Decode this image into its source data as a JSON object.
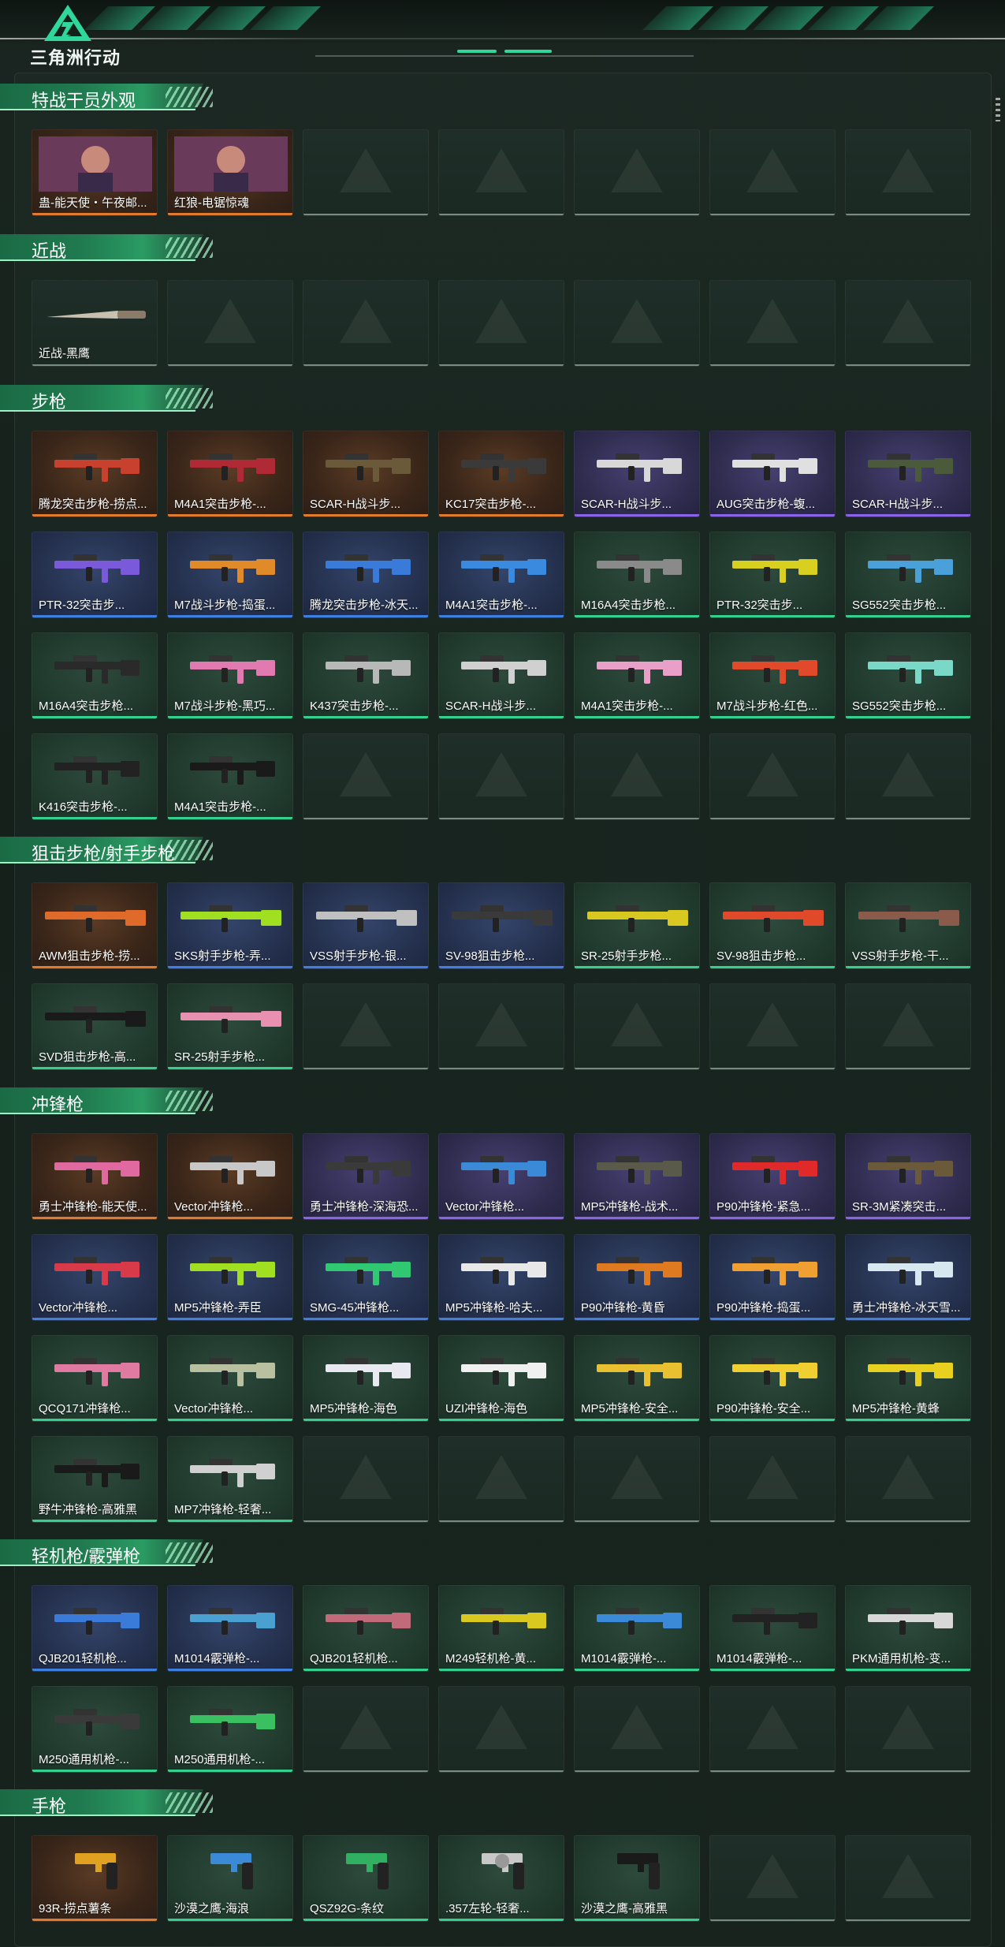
{
  "app": {
    "brand": "三角洲行动"
  },
  "sections": [
    {
      "title": "特战干员外观",
      "rows": [
        [
          {
            "label": "蛊-能天使・午夜邮...",
            "rarity": "gold",
            "icon": "operator-skin-art"
          },
          {
            "label": "红狼-电锯惊魂",
            "rarity": "gold",
            "icon": "operator-skin-art"
          },
          {
            "empty": true
          },
          {
            "empty": true
          },
          {
            "empty": true
          },
          {
            "empty": true
          },
          {
            "empty": true
          }
        ]
      ]
    },
    {
      "title": "近战",
      "rows": [
        [
          {
            "label": "近战-黑鹰",
            "rarity": "empty",
            "icon": "knife-icon"
          },
          {
            "empty": true
          },
          {
            "empty": true
          },
          {
            "empty": true
          },
          {
            "empty": true
          },
          {
            "empty": true
          },
          {
            "empty": true
          }
        ]
      ]
    },
    {
      "title": "步枪",
      "rows": [
        [
          {
            "label": "腾龙突击步枪-捞点...",
            "rarity": "gold",
            "icon": "rifle-icon",
            "color": "#c8412e"
          },
          {
            "label": "M4A1突击步枪-...",
            "rarity": "gold",
            "icon": "rifle-icon",
            "color": "#b02a36"
          },
          {
            "label": "SCAR-H战斗步...",
            "rarity": "gold",
            "icon": "rifle-icon",
            "color": "#6a5a3a"
          },
          {
            "label": "KC17突击步枪-...",
            "rarity": "gold",
            "icon": "rifle-icon",
            "color": "#3a3a3a"
          },
          {
            "label": "SCAR-H战斗步...",
            "rarity": "purple",
            "icon": "rifle-icon",
            "color": "#d8d8d8"
          },
          {
            "label": "AUG突击步枪-蝮...",
            "rarity": "purple",
            "icon": "rifle-icon",
            "color": "#e0e0e0"
          },
          {
            "label": "SCAR-H战斗步...",
            "rarity": "purple",
            "icon": "rifle-icon",
            "color": "#4a5a3a"
          }
        ],
        [
          {
            "label": "PTR-32突击步...",
            "rarity": "blue",
            "icon": "rifle-icon",
            "color": "#7a5ad8"
          },
          {
            "label": "M7战斗步枪-捣蛋...",
            "rarity": "blue",
            "icon": "rifle-icon",
            "color": "#e08a2a"
          },
          {
            "label": "腾龙突击步枪-冰天...",
            "rarity": "blue",
            "icon": "rifle-icon",
            "color": "#3a7ad8"
          },
          {
            "label": "M4A1突击步枪-...",
            "rarity": "blue",
            "icon": "rifle-icon",
            "color": "#3a8ae0"
          },
          {
            "label": "M16A4突击步枪...",
            "rarity": "green",
            "icon": "rifle-icon",
            "color": "#8a8a8a"
          },
          {
            "label": "PTR-32突击步...",
            "rarity": "green",
            "icon": "rifle-icon",
            "color": "#d8d020"
          },
          {
            "label": "SG552突击步枪...",
            "rarity": "green",
            "icon": "rifle-icon",
            "color": "#4aa0d8"
          }
        ],
        [
          {
            "label": "M16A4突击步枪...",
            "rarity": "green",
            "icon": "rifle-icon",
            "color": "#2a2a2a"
          },
          {
            "label": "M7战斗步枪-黑巧...",
            "rarity": "green",
            "icon": "rifle-icon",
            "color": "#e07ab0"
          },
          {
            "label": "K437突击步枪-...",
            "rarity": "green",
            "icon": "rifle-icon",
            "color": "#b8b8b8"
          },
          {
            "label": "SCAR-H战斗步...",
            "rarity": "green",
            "icon": "rifle-icon",
            "color": "#d0d0d0"
          },
          {
            "label": "M4A1突击步枪-...",
            "rarity": "green",
            "icon": "rifle-icon",
            "color": "#e8a0c8"
          },
          {
            "label": "M7战斗步枪-红色...",
            "rarity": "green",
            "icon": "rifle-icon",
            "color": "#e04a2a"
          },
          {
            "label": "SG552突击步枪...",
            "rarity": "green",
            "icon": "rifle-icon",
            "color": "#7ad8c8"
          }
        ],
        [
          {
            "label": "K416突击步枪-...",
            "rarity": "green",
            "icon": "rifle-icon",
            "color": "#222222"
          },
          {
            "label": "M4A1突击步枪-...",
            "rarity": "green",
            "icon": "rifle-icon",
            "color": "#1a1a1a"
          },
          {
            "empty": true
          },
          {
            "empty": true
          },
          {
            "empty": true
          },
          {
            "empty": true
          },
          {
            "empty": true
          }
        ]
      ]
    },
    {
      "title": "狙击步枪/射手步枪",
      "rows": [
        [
          {
            "label": "AWM狙击步枪-捞...",
            "rarity": "gold",
            "icon": "sniper-icon",
            "color": "#e06a2a"
          },
          {
            "label": "SKS射手步枪-弄...",
            "rarity": "blue",
            "icon": "sniper-icon",
            "color": "#a0e020"
          },
          {
            "label": "VSS射手步枪-银...",
            "rarity": "blue",
            "icon": "sniper-icon",
            "color": "#c0c0c0"
          },
          {
            "label": "SV-98狙击步枪...",
            "rarity": "blue",
            "icon": "sniper-icon",
            "color": "#3a3a3a"
          },
          {
            "label": "SR-25射手步枪...",
            "rarity": "green",
            "icon": "sniper-icon",
            "color": "#d8c820"
          },
          {
            "label": "SV-98狙击步枪...",
            "rarity": "green",
            "icon": "sniper-icon",
            "color": "#e04a2a"
          },
          {
            "label": "VSS射手步枪-干...",
            "rarity": "green",
            "icon": "sniper-icon",
            "color": "#8a5a4a"
          }
        ],
        [
          {
            "label": "SVD狙击步枪-高...",
            "rarity": "green",
            "icon": "sniper-icon",
            "color": "#1a1a1a"
          },
          {
            "label": "SR-25射手步枪...",
            "rarity": "green",
            "icon": "sniper-icon",
            "color": "#e890b0"
          },
          {
            "empty": true
          },
          {
            "empty": true
          },
          {
            "empty": true
          },
          {
            "empty": true
          },
          {
            "empty": true
          }
        ]
      ]
    },
    {
      "title": "冲锋枪",
      "rows": [
        [
          {
            "label": "勇士冲锋枪-能天使...",
            "rarity": "gold",
            "icon": "smg-icon",
            "color": "#e06aa0"
          },
          {
            "label": "Vector冲锋枪...",
            "rarity": "gold",
            "icon": "smg-icon",
            "color": "#c8c8c8"
          },
          {
            "label": "勇士冲锋枪-深海恐...",
            "rarity": "purple",
            "icon": "smg-icon",
            "color": "#3a3a3a"
          },
          {
            "label": "Vector冲锋枪...",
            "rarity": "purple",
            "icon": "smg-icon",
            "color": "#3a8ad8"
          },
          {
            "label": "MP5冲锋枪-战术...",
            "rarity": "purple",
            "icon": "smg-icon",
            "color": "#5a5a4a"
          },
          {
            "label": "P90冲锋枪-紧急...",
            "rarity": "purple",
            "icon": "smg-icon",
            "color": "#e02a2a"
          },
          {
            "label": "SR-3M紧凑突击...",
            "rarity": "purple",
            "icon": "smg-icon",
            "color": "#6a5a3a"
          }
        ],
        [
          {
            "label": "Vector冲锋枪...",
            "rarity": "blue",
            "icon": "smg-icon",
            "color": "#d83a4a"
          },
          {
            "label": "MP5冲锋枪-弄臣",
            "rarity": "blue",
            "icon": "smg-icon",
            "color": "#a0e020"
          },
          {
            "label": "SMG-45冲锋枪...",
            "rarity": "blue",
            "icon": "smg-icon",
            "color": "#30c870"
          },
          {
            "label": "MP5冲锋枪-哈夫...",
            "rarity": "blue",
            "icon": "smg-icon",
            "color": "#e8e8e8"
          },
          {
            "label": "P90冲锋枪-黄昏",
            "rarity": "blue",
            "icon": "smg-icon",
            "color": "#e07a20"
          },
          {
            "label": "P90冲锋枪-捣蛋...",
            "rarity": "blue",
            "icon": "smg-icon",
            "color": "#f0a030"
          },
          {
            "label": "勇士冲锋枪-冰天雪...",
            "rarity": "blue",
            "icon": "smg-icon",
            "color": "#d8e8f0"
          }
        ],
        [
          {
            "label": "QCQ171冲锋枪...",
            "rarity": "green",
            "icon": "smg-icon",
            "color": "#e07aa0"
          },
          {
            "label": "Vector冲锋枪...",
            "rarity": "green",
            "icon": "smg-icon",
            "color": "#b8c0a0"
          },
          {
            "label": "MP5冲锋枪-海色",
            "rarity": "green",
            "icon": "smg-icon",
            "color": "#e8e8f0"
          },
          {
            "label": "UZI冲锋枪-海色",
            "rarity": "green",
            "icon": "smg-icon",
            "color": "#f0f0f0"
          },
          {
            "label": "MP5冲锋枪-安全...",
            "rarity": "green",
            "icon": "smg-icon",
            "color": "#e8c030"
          },
          {
            "label": "P90冲锋枪-安全...",
            "rarity": "green",
            "icon": "smg-icon",
            "color": "#f0d030"
          },
          {
            "label": "MP5冲锋枪-黄蜂",
            "rarity": "green",
            "icon": "smg-icon",
            "color": "#e8d020"
          }
        ],
        [
          {
            "label": "野牛冲锋枪-高雅黑",
            "rarity": "green",
            "icon": "smg-icon",
            "color": "#1a1a1a"
          },
          {
            "label": "MP7冲锋枪-轻奢...",
            "rarity": "green",
            "icon": "smg-icon",
            "color": "#d0d0d0"
          },
          {
            "empty": true
          },
          {
            "empty": true
          },
          {
            "empty": true
          },
          {
            "empty": true
          },
          {
            "empty": true
          }
        ]
      ]
    },
    {
      "title": "轻机枪/霰弹枪",
      "rows": [
        [
          {
            "label": "QJB201轻机枪...",
            "rarity": "blue",
            "icon": "lmg-icon",
            "color": "#3a7ad8"
          },
          {
            "label": "M1014霰弹枪-...",
            "rarity": "blue",
            "icon": "shotgun-icon",
            "color": "#4aa0d0"
          },
          {
            "label": "QJB201轻机枪...",
            "rarity": "green",
            "icon": "lmg-icon",
            "color": "#c06a7a"
          },
          {
            "label": "M249轻机枪-黄...",
            "rarity": "green",
            "icon": "lmg-icon",
            "color": "#d8c820"
          },
          {
            "label": "M1014霰弹枪-...",
            "rarity": "green",
            "icon": "shotgun-icon",
            "color": "#3a8ad8"
          },
          {
            "label": "M1014霰弹枪-...",
            "rarity": "green",
            "icon": "shotgun-icon",
            "color": "#222222"
          },
          {
            "label": "PKM通用机枪-变...",
            "rarity": "green",
            "icon": "lmg-icon",
            "color": "#d8d8d8"
          }
        ],
        [
          {
            "label": "M250通用机枪-...",
            "rarity": "green",
            "icon": "lmg-icon",
            "color": "#3a3a3a"
          },
          {
            "label": "M250通用机枪-...",
            "rarity": "green",
            "icon": "lmg-icon",
            "color": "#3ac060"
          },
          {
            "empty": true
          },
          {
            "empty": true
          },
          {
            "empty": true
          },
          {
            "empty": true
          },
          {
            "empty": true
          }
        ]
      ]
    },
    {
      "title": "手枪",
      "rows": [
        [
          {
            "label": "93R-捞点薯条",
            "rarity": "gold",
            "icon": "pistol-icon",
            "color": "#e0a020"
          },
          {
            "label": "沙漠之鹰-海浪",
            "rarity": "green",
            "icon": "pistol-icon",
            "color": "#3a8ad8"
          },
          {
            "label": "QSZ92G-条纹",
            "rarity": "green",
            "icon": "pistol-icon",
            "color": "#30b060"
          },
          {
            "label": ".357左轮-轻奢...",
            "rarity": "green",
            "icon": "revolver-icon",
            "color": "#c8c8c8"
          },
          {
            "label": "沙漠之鹰-高雅黑",
            "rarity": "green",
            "icon": "pistol-icon",
            "color": "#1a1a1a"
          },
          {
            "empty": true
          },
          {
            "empty": true
          }
        ]
      ]
    }
  ]
}
